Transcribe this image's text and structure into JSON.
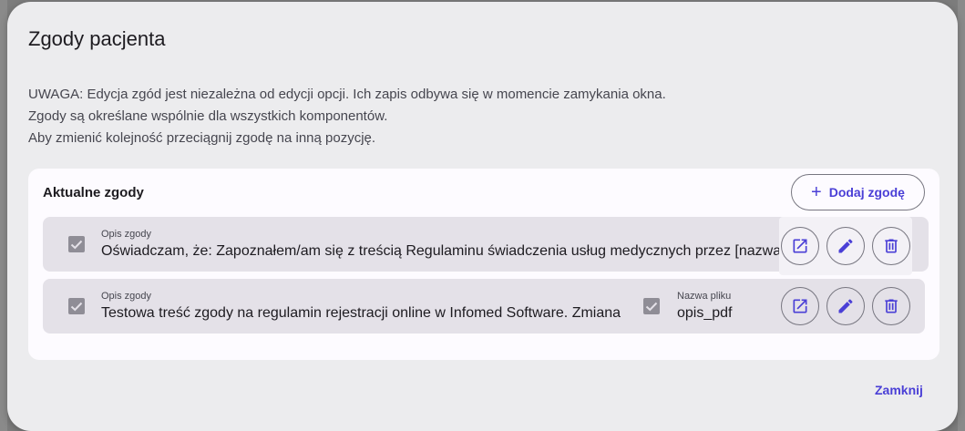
{
  "dialog": {
    "title": "Zgody pacjenta",
    "notice": [
      "UWAGA: Edycja zgód jest niezależna od edycji opcji. Ich zapis odbywa się w momencie zamykania okna.",
      "Zgody są określane wspólnie dla wszystkich komponentów.",
      "Aby zmienić kolejność przeciągnij zgodę na inną pozycję."
    ],
    "close_label": "Zamknij"
  },
  "card": {
    "title": "Aktualne zgody",
    "add_label": "Dodaj zgodę",
    "add_icon": "plus-icon"
  },
  "consents": [
    {
      "checked": true,
      "desc_label": "Opis zgody",
      "desc_value": "Oświadczam, że: Zapoznałem/am się z treścią Regulaminu świadczenia usług medycznych przez [nazwa placówki]"
    },
    {
      "checked": true,
      "desc_label": "Opis zgody",
      "desc_value": "Testowa treść zgody na regulamin rejestracji online w Infomed Software. Zmiana",
      "file_checked": true,
      "file_label": "Nazwa pliku",
      "file_value": "opis_pdf"
    }
  ],
  "row_actions": [
    "open-in-new-icon",
    "edit-pencil-icon",
    "delete-trash-icon"
  ],
  "colors": {
    "accent": "#4a3fd6",
    "dialog_bg": "#ececee",
    "row_bg": "#e4e1e8"
  }
}
